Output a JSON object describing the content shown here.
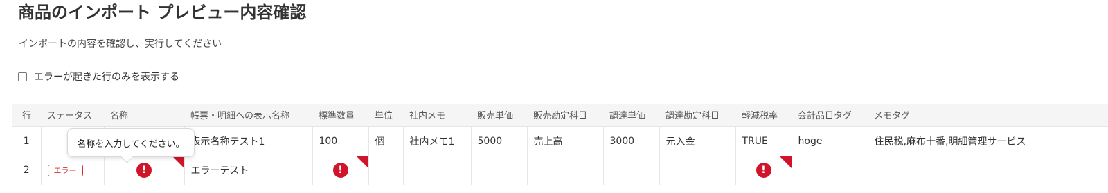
{
  "page": {
    "title": "商品のインポート プレビュー内容確認",
    "subtitle": "インポートの内容を確認し、実行してください",
    "filter_label": "エラーが起きた行のみを表示する",
    "filter_checked": false
  },
  "table": {
    "headers": [
      "行",
      "ステータス",
      "名称",
      "帳票・明細への表示名称",
      "標準数量",
      "単位",
      "社内メモ",
      "販売単価",
      "販売勘定科目",
      "調達単価",
      "調達勘定科目",
      "軽減税率",
      "会計品目タグ",
      "メモタグ"
    ],
    "rows": [
      {
        "row": "1",
        "status": "",
        "name": "",
        "display_name": "表示名称テスト1",
        "qty": "100",
        "unit": "個",
        "memo": "社内メモ1",
        "sale_price": "5000",
        "sale_account": "売上高",
        "purchase_price": "3000",
        "purchase_account": "元入金",
        "reduced_tax": "TRUE",
        "item_tag": "hoge",
        "memo_tag": "住民税,麻布十番,明細管理サービス"
      },
      {
        "row": "2",
        "status": "エラー",
        "name": "",
        "display_name": "エラーテスト",
        "qty": "",
        "unit": "",
        "memo": "",
        "sale_price": "",
        "sale_account": "",
        "purchase_price": "",
        "purchase_account": "",
        "reduced_tax": "",
        "item_tag": "",
        "memo_tag": ""
      }
    ]
  },
  "error_icon_glyph": "!",
  "tooltip": {
    "text": "名称を入力してください。"
  },
  "colors": {
    "error": "#d0152a",
    "header_bg": "#f5f5f5",
    "border": "#e6e6e6"
  }
}
